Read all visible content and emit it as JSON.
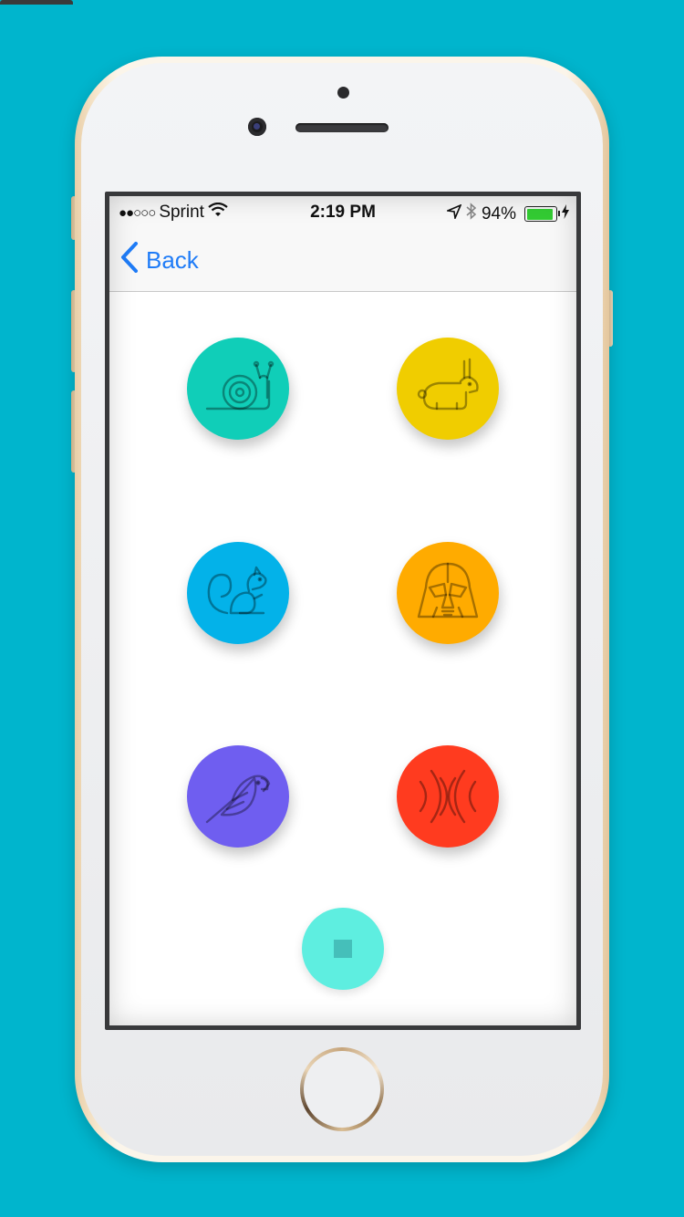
{
  "status_bar": {
    "signal_dots": "●●○○○",
    "carrier": "Sprint",
    "time": "2:19 PM",
    "battery_percent": "94%",
    "battery_level": 0.94,
    "icons": [
      "wifi-icon",
      "location-arrow-icon",
      "bluetooth-icon",
      "battery-icon",
      "charging-bolt-icon"
    ]
  },
  "nav": {
    "back_label": "Back",
    "back_icon": "chevron-left-icon"
  },
  "sound_buttons": [
    {
      "icon": "snail-icon",
      "color": "#10ceb8"
    },
    {
      "icon": "rabbit-icon",
      "color": "#f0cd00"
    },
    {
      "icon": "squirrel-icon",
      "color": "#03b2e9"
    },
    {
      "icon": "darth-vader-helmet-icon",
      "color": "#ffab00"
    },
    {
      "icon": "parrot-icon",
      "color": "#6f5ef0"
    },
    {
      "icon": "echo-waves-icon",
      "color": "#ff3b1f"
    }
  ],
  "stop_button": {
    "icon": "stop-icon",
    "color": "#5eeee0"
  },
  "colors": {
    "background": "#00b5cd",
    "accent_blue": "#1f7cf7",
    "icon_stroke": "rgba(0,0,0,0.35)"
  }
}
